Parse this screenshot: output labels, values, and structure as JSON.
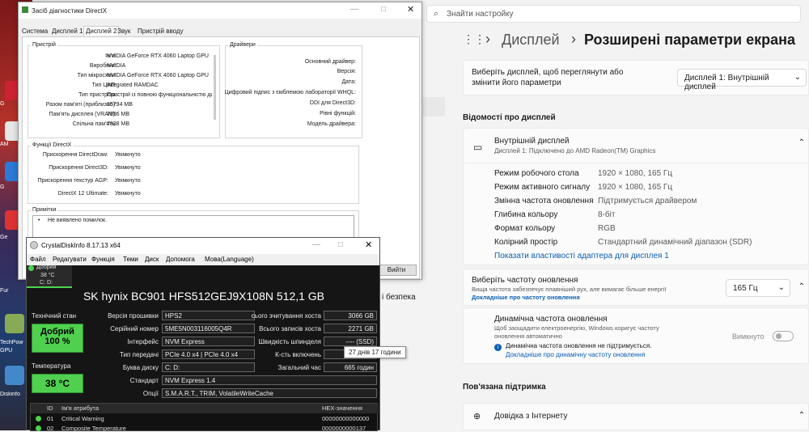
{
  "desktop": {
    "icons": [
      "G",
      "AM",
      "G",
      "Ge",
      "Fur",
      "TechPow",
      "GPU",
      "Diskinfo"
    ]
  },
  "settings": {
    "search_placeholder": "Знайти настройку",
    "breadcrumb1": "Дисплей",
    "breadcrumb_sep": "›",
    "breadcrumb2": "Розширені параметри екрана",
    "choose_display": "Виберіть дисплей, щоб переглянути або змінити його параметри",
    "display_select": "Дисплей 1: Внутрішній дисплей",
    "display_info_header": "Відомості про дисплей",
    "internal_display": "Внутрішній дисплей",
    "internal_sub": "Дисплей 1: Підключено до AMD Radeon(TM) Graphics",
    "props": [
      {
        "k": "Режим робочого стола",
        "v": "1920 × 1080, 165 Гц"
      },
      {
        "k": "Режим активного сигналу",
        "v": "1920 × 1080, 165 Гц"
      },
      {
        "k": "Змінна частота оновлення",
        "v": "Підтримується драйвером"
      },
      {
        "k": "Глибина кольору",
        "v": "8-біт"
      },
      {
        "k": "Формат кольору",
        "v": "RGB"
      },
      {
        "k": "Колірний простір",
        "v": "Стандартний динамічний діапазон (SDR)"
      }
    ],
    "adapter_link": "Показати властивості адаптера для дисплея 1",
    "refresh_title": "Виберіть частоту оновлення",
    "refresh_sub": "Вища частота забезпечує плавніший рух, але вимагає більше енергії",
    "refresh_more": "Докладніше про частоту оновлення",
    "refresh_value": "165 Гц",
    "dyn_title": "Динамічна частота оновлення",
    "dyn_sub": "Щоб заощадити електроенергію, Windows коригує частоту оновлення автоматично",
    "dyn_toggle": "Вимкнуто",
    "dyn_warn": "Динамічна частота оновлення не підтримується.",
    "dyn_more": "Докладніше про динамічну частоту оновлення",
    "support_header": "Пов'язана підтримка",
    "help_internet": "Довідка з Інтернету",
    "security_fragment": "і безпека"
  },
  "dxdiag": {
    "title": "Засіб діагностики DirectX",
    "tabs": [
      "Система",
      "Дисплей 1",
      "Дисплей 2",
      "Звук",
      "Пристрій вводу"
    ],
    "device_group": "Пристрій",
    "device": [
      {
        "k": "Ім'я:",
        "v": "NVIDIA GeForce RTX 4060 Laptop GPU"
      },
      {
        "k": "Виробник:",
        "v": "NVIDIA"
      },
      {
        "k": "Тип мікросхем:",
        "v": "NVIDIA GeForce RTX 4060 Laptop GPU"
      },
      {
        "k": "Тип ЦАП:",
        "v": "Integrated RAMDAC"
      },
      {
        "k": "Тип пристрою:",
        "v": "Пристрій із повною функціональністю ди"
      },
      {
        "k": "Разом пам'яті (приблизно):",
        "v": "15794 MB"
      },
      {
        "k": "Пам'ять дисплея (VRAM):",
        "v": "7956 MB"
      },
      {
        "k": "Спільна пам'ять:",
        "v": "7838 MB"
      }
    ],
    "drivers_group": "Драйвери",
    "drivers": [
      "Основний драйвер:",
      "Версія:",
      "Дата:",
      "Цифровий підпис з ємблемою лабораторії WHQL:",
      "DDI для Direct3D:",
      "Рівні функцій:",
      "Модель драйвера:"
    ],
    "features_group": "Функції DirectX",
    "features": [
      {
        "k": "Прискорення DirectDraw:",
        "v": "Увімкнуто"
      },
      {
        "k": "Прискорення Direct3D:",
        "v": "Увімкнуто"
      },
      {
        "k": "Прискорення текстур AGP:",
        "v": "Увімкнуто"
      },
      {
        "k": "DirectX 12 Ultimate:",
        "v": "Увімкнуто"
      }
    ],
    "notes_group": "Примітки",
    "notes_text": "Не виявлено помилок.",
    "exit_btn": "Вийти"
  },
  "crystal": {
    "title": "CrystalDiskInfo 8.17.13 x64",
    "menu": [
      "Файл",
      "Редагувати",
      "Функція",
      "Теми",
      "Диск",
      "Допомога",
      "Мова(Language)"
    ],
    "drive_status": "Добрий",
    "drive_temp": "38 °C",
    "drive_letter": "C: D:",
    "model": "SK hynix BC901 HFS512GEJ9X108N 512,1 GB",
    "health_label": "Технічний стан",
    "health_word": "Добрий",
    "health_pct": "100 %",
    "temp_label": "Температура",
    "temp_val": "38 °C",
    "left": [
      {
        "k": "Версія прошивки",
        "v": "HPS2"
      },
      {
        "k": "Серійний номер",
        "v": "5ME5N003116005Q4R"
      },
      {
        "k": "Інтерфейс",
        "v": "NVM Express"
      },
      {
        "k": "Тип передачі",
        "v": "PCIe 4.0 x4 | PCIe 4.0 x4"
      },
      {
        "k": "Буква диску",
        "v": "C: D:"
      }
    ],
    "right": [
      {
        "k": "сього зчитування хоста",
        "v": "3066 GB"
      },
      {
        "k": "Всього записів хоста",
        "v": "2271 GB"
      },
      {
        "k": "Швидкість шпинделя",
        "v": "---- (SSD)"
      },
      {
        "k": "К-сть включень",
        "v": ""
      },
      {
        "k": "Загальний час",
        "v": "665 годин"
      }
    ],
    "standard_k": "Стандарт",
    "standard_v": "NVM Express 1.4",
    "options_k": "Опції",
    "options_v": "S.M.A.R.T., TRIM, VolatileWriteCache",
    "tooltip": "27 днів 17 години",
    "table_headers": [
      "ID",
      "Ім'я атрибута",
      "HEX-значення"
    ],
    "rows": [
      {
        "id": "01",
        "name": "Critical Warning",
        "hex": "00000000000000"
      },
      {
        "id": "02",
        "name": "Composite Temperature",
        "hex": "0000000000137"
      }
    ]
  }
}
